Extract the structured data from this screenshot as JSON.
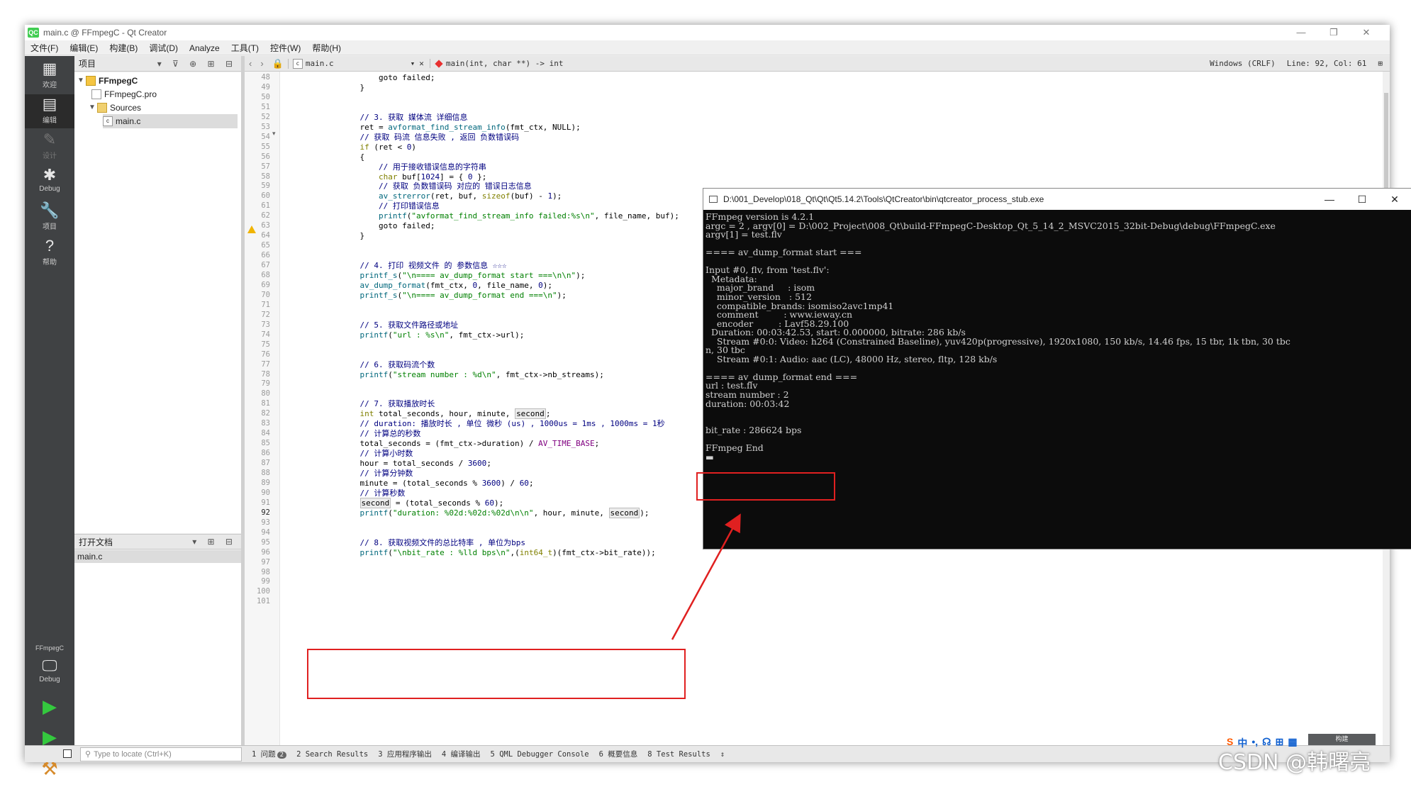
{
  "window": {
    "title": "main.c @ FFmpegC - Qt Creator",
    "logo": "QC",
    "controls": [
      "—",
      "❐",
      "✕"
    ]
  },
  "menu": [
    "文件(F)",
    "编辑(E)",
    "构建(B)",
    "调试(D)",
    "Analyze",
    "工具(T)",
    "控件(W)",
    "帮助(H)"
  ],
  "modes": [
    {
      "label": "欢迎",
      "icon": "grid-icon",
      "glyph": "▦"
    },
    {
      "label": "编辑",
      "icon": "edit-icon",
      "glyph": "▤"
    },
    {
      "label": "设计",
      "icon": "pencil-icon",
      "glyph": "✎"
    },
    {
      "label": "Debug",
      "icon": "bug-icon",
      "glyph": "✱"
    },
    {
      "label": "项目",
      "icon": "wrench-icon",
      "glyph": "🔧"
    },
    {
      "label": "帮助",
      "icon": "help-icon",
      "glyph": "?"
    }
  ],
  "kit": {
    "name": "FFmpegC",
    "mode": "Debug"
  },
  "project_panel": {
    "title": "项目",
    "tools": "▾ ⊽ ⊕ ⊞ ⊟"
  },
  "tree": [
    {
      "label": "FFmpegC",
      "icon": "proj",
      "depth": 0,
      "arrow": "▼"
    },
    {
      "label": "FFmpegC.pro",
      "icon": "file",
      "depth": 1,
      "arrow": ""
    },
    {
      "label": "Sources",
      "icon": "folder",
      "depth": 1,
      "arrow": "▼"
    },
    {
      "label": "main.c",
      "icon": "c",
      "depth": 2,
      "arrow": ""
    }
  ],
  "open_docs": {
    "title": "打开文档",
    "tools": "▾ ⊞ ⊟",
    "items": [
      "main.c"
    ]
  },
  "editor": {
    "file": "main.c",
    "function": "main(int, char **) -> int",
    "encoding": "Windows (CRLF)",
    "position": "Line: 92, Col: 61",
    "current_line": 92,
    "warning_line": 62,
    "lines": [
      {
        "n": 48,
        "t": [
          [
            "        goto failed;",
            ""
          ]
        ]
      },
      {
        "n": 49,
        "t": [
          [
            "    }",
            ""
          ]
        ]
      },
      {
        "n": 50,
        "t": []
      },
      {
        "n": 51,
        "t": []
      },
      {
        "n": 52,
        "t": [
          [
            "    // 3. 获取 媒体流 详细信息",
            "cmt"
          ]
        ]
      },
      {
        "n": 53,
        "t": [
          [
            "    ret = ",
            ""
          ],
          [
            "avformat_find_stream_info",
            "fn"
          ],
          [
            "(fmt_ctx, NULL);",
            ""
          ]
        ]
      },
      {
        "n": 54,
        "t": [
          [
            "    // 获取 码流 信息失败 , 返回 负数错误码",
            "cmt"
          ]
        ]
      },
      {
        "n": 55,
        "t": [
          [
            "    ",
            "",
            ""
          ],
          [
            "if",
            "kw"
          ],
          [
            " (ret < ",
            ""
          ],
          [
            "0",
            "num"
          ],
          [
            ")",
            ""
          ]
        ]
      },
      {
        "n": 56,
        "t": [
          [
            "    {",
            ""
          ]
        ]
      },
      {
        "n": 57,
        "t": [
          [
            "        // 用于接收错误信息的字符串",
            "cmt"
          ]
        ]
      },
      {
        "n": 58,
        "t": [
          [
            "        ",
            ""
          ],
          [
            "char",
            "kw"
          ],
          [
            " buf[",
            ""
          ],
          [
            "1024",
            "num"
          ],
          [
            "] = { ",
            ""
          ],
          [
            "0",
            "num"
          ],
          [
            " };",
            ""
          ]
        ]
      },
      {
        "n": 59,
        "t": [
          [
            "        // 获取 负数错误码 对应的 错误日志信息",
            "cmt"
          ]
        ]
      },
      {
        "n": 60,
        "t": [
          [
            "        ",
            ""
          ],
          [
            "av_strerror",
            "fn"
          ],
          [
            "(ret, buf, ",
            ""
          ],
          [
            "sizeof",
            "kw"
          ],
          [
            "(buf) - ",
            ""
          ],
          [
            "1",
            "num"
          ],
          [
            ");",
            ""
          ]
        ]
      },
      {
        "n": 61,
        "t": [
          [
            "        // 打印错误信息",
            "cmt"
          ]
        ]
      },
      {
        "n": 62,
        "t": [
          [
            "        ",
            ""
          ],
          [
            "printf",
            "fn"
          ],
          [
            "(",
            ""
          ],
          [
            "\"avformat_find_stream_info failed:%s\\n\"",
            "str"
          ],
          [
            ", file_name, buf);",
            ""
          ]
        ]
      },
      {
        "n": 63,
        "t": [
          [
            "        goto failed;",
            ""
          ]
        ]
      },
      {
        "n": 64,
        "t": [
          [
            "    }",
            ""
          ]
        ]
      },
      {
        "n": 65,
        "t": []
      },
      {
        "n": 66,
        "t": []
      },
      {
        "n": 67,
        "t": [
          [
            "    // 4. 打印 视频文件 的 参数信息 ☆☆☆",
            "cmt"
          ]
        ]
      },
      {
        "n": 68,
        "t": [
          [
            "    ",
            ""
          ],
          [
            "printf_s",
            "fn"
          ],
          [
            "(",
            ""
          ],
          [
            "\"\\n==== av_dump_format start ===\\n\\n\"",
            "str"
          ],
          [
            ");",
            ""
          ]
        ]
      },
      {
        "n": 69,
        "t": [
          [
            "    ",
            ""
          ],
          [
            "av_dump_format",
            "fn"
          ],
          [
            "(fmt_ctx, ",
            ""
          ],
          [
            "0",
            "num"
          ],
          [
            ", file_name, ",
            ""
          ],
          [
            "0",
            "num"
          ],
          [
            ");",
            ""
          ]
        ]
      },
      {
        "n": 70,
        "t": [
          [
            "    ",
            ""
          ],
          [
            "printf_s",
            "fn"
          ],
          [
            "(",
            ""
          ],
          [
            "\"\\n==== av_dump_format end ===\\n\"",
            "str"
          ],
          [
            ");",
            ""
          ]
        ]
      },
      {
        "n": 71,
        "t": []
      },
      {
        "n": 72,
        "t": []
      },
      {
        "n": 73,
        "t": [
          [
            "    // 5. 获取文件路径或地址",
            "cmt"
          ]
        ]
      },
      {
        "n": 74,
        "t": [
          [
            "    ",
            ""
          ],
          [
            "printf",
            "fn"
          ],
          [
            "(",
            ""
          ],
          [
            "\"url : %s\\n\"",
            "str"
          ],
          [
            ", fmt_ctx->url);",
            ""
          ]
        ]
      },
      {
        "n": 75,
        "t": []
      },
      {
        "n": 76,
        "t": []
      },
      {
        "n": 77,
        "t": [
          [
            "    // 6. 获取码流个数",
            "cmt"
          ]
        ]
      },
      {
        "n": 78,
        "t": [
          [
            "    ",
            ""
          ],
          [
            "printf",
            "fn"
          ],
          [
            "(",
            ""
          ],
          [
            "\"stream number : %d\\n\"",
            "str"
          ],
          [
            ", fmt_ctx->nb_streams);",
            ""
          ]
        ]
      },
      {
        "n": 79,
        "t": []
      },
      {
        "n": 80,
        "t": []
      },
      {
        "n": 81,
        "t": [
          [
            "    // 7. 获取播放时长",
            "cmt"
          ]
        ]
      },
      {
        "n": 82,
        "t": [
          [
            "    ",
            ""
          ],
          [
            "int",
            "kw"
          ],
          [
            " total_seconds, hour, minute, ",
            ""
          ],
          [
            "second",
            "hl"
          ],
          [
            ";",
            ""
          ]
        ]
      },
      {
        "n": 83,
        "t": [
          [
            "    // duration: 播放时长 , 单位 微秒 (us) , 1000us = 1ms , 1000ms = 1秒",
            "cmt"
          ]
        ]
      },
      {
        "n": 84,
        "t": [
          [
            "    // 计算总的秒数",
            "cmt"
          ]
        ]
      },
      {
        "n": 85,
        "t": [
          [
            "    total_seconds = (fmt_ctx->duration) / ",
            ""
          ],
          [
            "AV_TIME_BASE",
            "mac"
          ],
          [
            ";",
            ""
          ]
        ]
      },
      {
        "n": 86,
        "t": [
          [
            "    // 计算小时数",
            "cmt"
          ]
        ]
      },
      {
        "n": 87,
        "t": [
          [
            "    hour = total_seconds / ",
            ""
          ],
          [
            "3600",
            "num"
          ],
          [
            ";",
            ""
          ]
        ]
      },
      {
        "n": 88,
        "t": [
          [
            "    // 计算分钟数",
            "cmt"
          ]
        ]
      },
      {
        "n": 89,
        "t": [
          [
            "    minute = (total_seconds % ",
            ""
          ],
          [
            "3600",
            "num"
          ],
          [
            ") / ",
            ""
          ],
          [
            "60",
            "num"
          ],
          [
            ";",
            ""
          ]
        ]
      },
      {
        "n": 90,
        "t": [
          [
            "    // 计算秒数",
            "cmt"
          ]
        ]
      },
      {
        "n": 91,
        "t": [
          [
            "    ",
            ""
          ],
          [
            "second",
            "hl"
          ],
          [
            " = (total_seconds % ",
            ""
          ],
          [
            "60",
            "num"
          ],
          [
            ");",
            ""
          ]
        ]
      },
      {
        "n": 92,
        "t": [
          [
            "    ",
            ""
          ],
          [
            "printf",
            "fn"
          ],
          [
            "(",
            ""
          ],
          [
            "\"duration: %02d:%02d:%02d\\n\\n\"",
            "str"
          ],
          [
            ", hour, minute, ",
            ""
          ],
          [
            "second",
            "hl"
          ],
          [
            ");",
            ""
          ]
        ]
      },
      {
        "n": 93,
        "t": []
      },
      {
        "n": 94,
        "t": []
      },
      {
        "n": 95,
        "t": [
          [
            "    // 8. 获取视频文件的总比特率 , 单位为bps",
            "cmt"
          ]
        ]
      },
      {
        "n": 96,
        "t": [
          [
            "    ",
            ""
          ],
          [
            "printf",
            "fn"
          ],
          [
            "(",
            ""
          ],
          [
            "\"\\nbit_rate : %lld bps\\n\"",
            "str"
          ],
          [
            ",(",
            ""
          ],
          [
            "int64_t",
            "kw"
          ],
          [
            ")(fmt_ctx->bit_rate));",
            ""
          ]
        ]
      },
      {
        "n": 97,
        "t": []
      },
      {
        "n": 98,
        "t": []
      },
      {
        "n": 99,
        "t": []
      },
      {
        "n": 100,
        "t": []
      },
      {
        "n": 101,
        "t": []
      }
    ]
  },
  "console": {
    "title": "D:\\001_Develop\\018_Qt\\Qt\\Qt5.14.2\\Tools\\QtCreator\\bin\\qtcreator_process_stub.exe",
    "controls": [
      "—",
      "☐",
      "✕"
    ],
    "lines": [
      "FFmpeg version is 4.2.1",
      "argc = 2 , argv[0] = D:\\002_Project\\008_Qt\\build-FFmpegC-Desktop_Qt_5_14_2_MSVC2015_32bit-Debug\\debug\\FFmpegC.exe",
      "argv[1] = test.flv",
      "",
      "==== av_dump_format start ===",
      "",
      "Input #0, flv, from 'test.flv':",
      "  Metadata:",
      "    major_brand     : isom",
      "    minor_version   : 512",
      "    compatible_brands: isomiso2avc1mp41",
      "    comment         : www.ieway.cn",
      "    encoder         : Lavf58.29.100",
      "  Duration: 00:03:42.53, start: 0.000000, bitrate: 286 kb/s",
      "    Stream #0:0: Video: h264 (Constrained Baseline), yuv420p(progressive), 1920x1080, 150 kb/s, 14.46 fps, 15 tbr, 1k tbn, 30 tbc",
      "n, 30 tbc",
      "    Stream #0:1: Audio: aac (LC), 48000 Hz, stereo, fltp, 128 kb/s",
      "",
      "==== av_dump_format end ===",
      "url : test.flv",
      "stream number : 2",
      "duration: 00:03:42",
      "",
      "",
      "bit_rate : 286624 bps",
      "",
      "FFmpeg End",
      "▬"
    ]
  },
  "statusbar": {
    "locator_placeholder": "Type to locate (Ctrl+K)",
    "tabs": [
      "1 问题",
      "2 Search Results",
      "3 应用程序输出",
      "4 编译输出",
      "5 QML Debugger Console",
      "6 概要信息",
      "8 Test Results",
      "⇕"
    ],
    "issues_count": "2"
  },
  "build_button": {
    "label": "构建"
  },
  "watermark": {
    "text": "CSDN @韩曙亮"
  },
  "ime": {
    "items": [
      "S",
      "中",
      "•,",
      "☊",
      "⊞",
      "▦"
    ]
  }
}
